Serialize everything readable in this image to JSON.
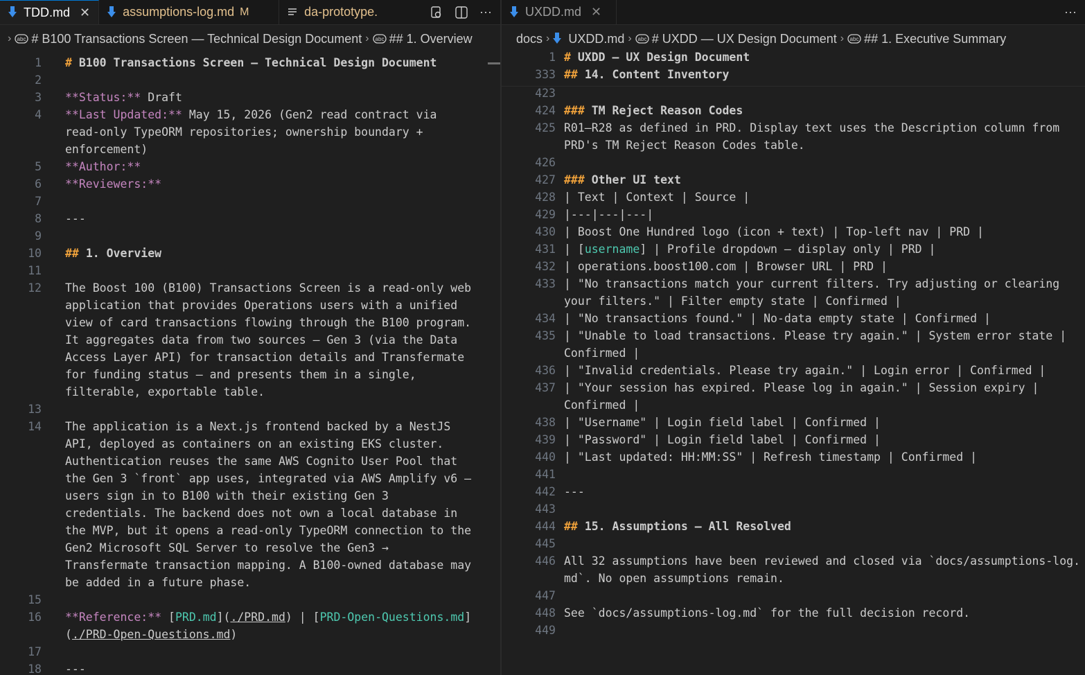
{
  "left": {
    "tabs": [
      {
        "label": "TDD.md",
        "icon": "markdown-icon",
        "active": true
      },
      {
        "label": "assumptions-log.md",
        "mark": "M",
        "icon": "markdown-icon"
      },
      {
        "label": "da-prototype.",
        "icon": "lines-icon"
      }
    ],
    "breadcrumb": [
      "# B100 Transactions Screen — Technical Design Document",
      "## 1. Overview"
    ],
    "lines": [
      {
        "n": "1",
        "t": "# B100 Transactions Screen — Technical Design Document"
      },
      {
        "n": "2",
        "t": ""
      },
      {
        "n": "3",
        "t": "**Status:** Draft"
      },
      {
        "n": "4",
        "t": "**Last Updated:** May 15, 2026 (Gen2 read contract via"
      },
      {
        "n": "",
        "t": "read-only TypeORM repositories; ownership boundary +"
      },
      {
        "n": "",
        "t": "enforcement)"
      },
      {
        "n": "5",
        "t": "**Author:**"
      },
      {
        "n": "6",
        "t": "**Reviewers:**"
      },
      {
        "n": "7",
        "t": ""
      },
      {
        "n": "8",
        "t": "---"
      },
      {
        "n": "9",
        "t": ""
      },
      {
        "n": "10",
        "t": "## 1. Overview"
      },
      {
        "n": "11",
        "t": ""
      },
      {
        "n": "12",
        "t": "The Boost 100 (B100) Transactions Screen is a read-only web"
      },
      {
        "n": "",
        "t": "application that provides Operations users with a unified"
      },
      {
        "n": "",
        "t": "view of card transactions flowing through the B100 program."
      },
      {
        "n": "",
        "t": "It aggregates data from two sources — Gen 3 (via the Data"
      },
      {
        "n": "",
        "t": "Access Layer API) for transaction details and Transfermate"
      },
      {
        "n": "",
        "t": "for funding status — and presents them in a single,"
      },
      {
        "n": "",
        "t": "filterable, exportable table."
      },
      {
        "n": "13",
        "t": ""
      },
      {
        "n": "14",
        "t": "The application is a Next.js frontend backed by a NestJS"
      },
      {
        "n": "",
        "t": "API, deployed as containers on an existing EKS cluster."
      },
      {
        "n": "",
        "t": "Authentication reuses the same AWS Cognito User Pool that"
      },
      {
        "n": "",
        "t": "the Gen 3 `front` app uses, integrated via AWS Amplify v6 —"
      },
      {
        "n": "",
        "t": "users sign in to B100 with their existing Gen 3"
      },
      {
        "n": "",
        "t": "credentials. The backend does not own a local database in"
      },
      {
        "n": "",
        "t": "the MVP, but it opens a read-only TypeORM connection to the"
      },
      {
        "n": "",
        "t": "Gen2 Microsoft SQL Server to resolve the Gen3 →"
      },
      {
        "n": "",
        "t": "Transfermate transaction mapping. A B100-owned database may"
      },
      {
        "n": "",
        "t": "be added in a future phase."
      },
      {
        "n": "15",
        "t": ""
      },
      {
        "n": "16",
        "t": "**Reference:** [PRD.md](./PRD.md) | [PRD-Open-Questions.md]"
      },
      {
        "n": "",
        "t": "(./PRD-Open-Questions.md)"
      },
      {
        "n": "17",
        "t": ""
      },
      {
        "n": "18",
        "t": "---"
      }
    ]
  },
  "right": {
    "tabs": [
      {
        "label": "UXDD.md",
        "icon": "markdown-icon"
      }
    ],
    "breadcrumb": [
      "docs",
      "UXDD.md",
      "# UXDD — UX Design Document",
      "## 1. Executive Summary"
    ],
    "sticky": [
      {
        "n": "1",
        "t": "# UXDD — UX Design Document"
      },
      {
        "n": "333",
        "t": "## 14. Content Inventory"
      }
    ],
    "lines": [
      {
        "n": "423",
        "t": ""
      },
      {
        "n": "424",
        "t": "### TM Reject Reason Codes"
      },
      {
        "n": "425",
        "t": "R01–R28 as defined in PRD. Display text uses the Description column from"
      },
      {
        "n": "",
        "t": "PRD's TM Reject Reason Codes table."
      },
      {
        "n": "426",
        "t": ""
      },
      {
        "n": "427",
        "t": "### Other UI text"
      },
      {
        "n": "428",
        "t": "| Text | Context | Source |"
      },
      {
        "n": "429",
        "t": "|---|---|---|"
      },
      {
        "n": "430",
        "t": "| Boost One Hundred logo (icon + text) | Top-left nav | PRD |"
      },
      {
        "n": "431",
        "t": "| [username] | Profile dropdown — display only | PRD |"
      },
      {
        "n": "432",
        "t": "| operations.boost100.com | Browser URL | PRD |"
      },
      {
        "n": "433",
        "t": "| \"No transactions match your current filters. Try adjusting or clearing"
      },
      {
        "n": "",
        "t": "your filters.\" | Filter empty state | Confirmed |"
      },
      {
        "n": "434",
        "t": "| \"No transactions found.\" | No-data empty state | Confirmed |"
      },
      {
        "n": "435",
        "t": "| \"Unable to load transactions. Please try again.\" | System error state |"
      },
      {
        "n": "",
        "t": "Confirmed |"
      },
      {
        "n": "436",
        "t": "| \"Invalid credentials. Please try again.\" | Login error | Confirmed |"
      },
      {
        "n": "437",
        "t": "| \"Your session has expired. Please log in again.\" | Session expiry |"
      },
      {
        "n": "",
        "t": "Confirmed |"
      },
      {
        "n": "438",
        "t": "| \"Username\" | Login field label | Confirmed |"
      },
      {
        "n": "439",
        "t": "| \"Password\" | Login field label | Confirmed |"
      },
      {
        "n": "440",
        "t": "| \"Last updated: HH:MM:SS\" | Refresh timestamp | Confirmed |"
      },
      {
        "n": "441",
        "t": ""
      },
      {
        "n": "442",
        "t": "---"
      },
      {
        "n": "443",
        "t": ""
      },
      {
        "n": "444",
        "t": "## 15. Assumptions — All Resolved"
      },
      {
        "n": "445",
        "t": ""
      },
      {
        "n": "446",
        "t": "All 32 assumptions have been reviewed and closed via `docs/assumptions-log."
      },
      {
        "n": "",
        "t": "md`. No open assumptions remain."
      },
      {
        "n": "447",
        "t": ""
      },
      {
        "n": "448",
        "t": "See `docs/assumptions-log.md` for the full decision record."
      },
      {
        "n": "449",
        "t": ""
      }
    ]
  }
}
